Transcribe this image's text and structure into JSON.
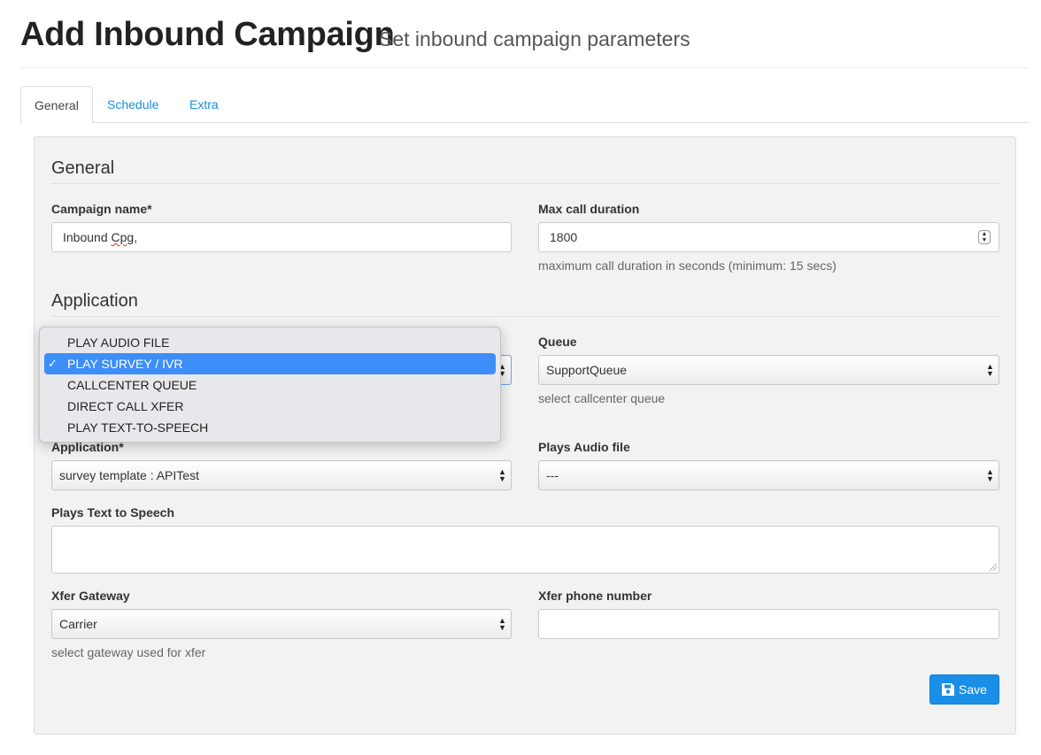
{
  "header": {
    "title": "Add Inbound Campaign",
    "subtitle": "Set inbound campaign parameters"
  },
  "tabs": [
    {
      "label": "General",
      "active": true
    },
    {
      "label": "Schedule",
      "active": false
    },
    {
      "label": "Extra",
      "active": false
    }
  ],
  "general": {
    "section_title": "General",
    "campaign_name": {
      "label": "Campaign name*",
      "value_prefix": "Inbound ",
      "value_misspelled": "Cpg",
      "value_suffix": ","
    },
    "max_call_duration": {
      "label": "Max call duration",
      "value": "1800",
      "help": "maximum call duration in seconds (minimum: 15 secs)"
    }
  },
  "application": {
    "section_title": "Application",
    "queue": {
      "label": "Queue",
      "value": "SupportQueue",
      "help": "select callcenter queue"
    },
    "application": {
      "label": "Application*",
      "value": "survey template : APITest"
    },
    "plays_audio_file": {
      "label": "Plays Audio file",
      "value": "---"
    },
    "plays_tts": {
      "label": "Plays Text to Speech",
      "value": ""
    },
    "xfer_gateway": {
      "label": "Xfer Gateway",
      "value": "Carrier",
      "help": "select gateway used for xfer"
    },
    "xfer_phone": {
      "label": "Xfer phone number",
      "value": ""
    }
  },
  "dropdown": {
    "options": [
      "PLAY AUDIO FILE",
      "PLAY SURVEY / IVR",
      "CALLCENTER QUEUE",
      "DIRECT CALL XFER",
      "PLAY TEXT-TO-SPEECH"
    ],
    "selected_index": 1,
    "check_mark": "✓"
  },
  "save_button": {
    "label": "Save",
    "icon": "floppy-disk-icon"
  },
  "colors": {
    "accent": "#1a8fe8",
    "link": "#1a8fd9",
    "dropdown_selected": "#3d8ef8"
  }
}
